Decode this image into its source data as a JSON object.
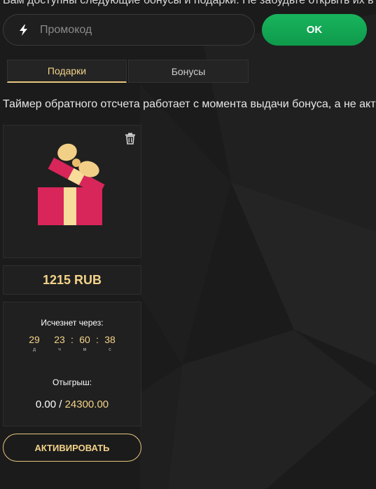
{
  "header": {
    "intro_text": "Вам доступны следующие бонусы и подарки. Не забудьте открыть их в"
  },
  "promo": {
    "placeholder": "Промокод",
    "icon": "lightning-icon",
    "submit_label": "OK"
  },
  "tabs": [
    {
      "label": "Подарки",
      "active": true
    },
    {
      "label": "Бонусы",
      "active": false
    }
  ],
  "info_text": "Таймер обратного отсчета работает с момента выдачи бонуса, а не активации",
  "gift_card": {
    "image_icon": "gift-box-icon",
    "delete_icon": "trash-icon",
    "amount": "1215 RUB",
    "expires_label": "Исчезнет через:",
    "timer": [
      {
        "value": "29",
        "unit": "д"
      },
      {
        "value": "23",
        "unit": "ч"
      },
      {
        "value": "60",
        "unit": "м"
      },
      {
        "value": "38",
        "unit": "с"
      }
    ],
    "wager_label": "Отыгрыш:",
    "wager_current": "0.00",
    "wager_separator": "/",
    "wager_total": "24300.00",
    "activate_label": "АКТИВИРОВАТЬ"
  },
  "colors": {
    "background": "#1b1b1b",
    "accent_gold": "#f3d389",
    "ok_green": "#14a954",
    "gift_red": "#d8255a",
    "gift_ribbon": "#f7dc9a"
  }
}
